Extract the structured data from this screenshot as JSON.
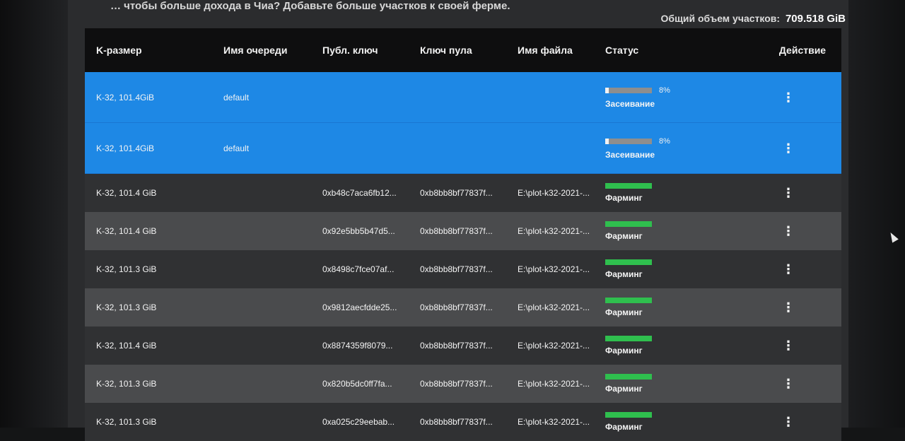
{
  "notice": "… чтобы больше дохода в Чиа? Добавьте больше участков к своей ферме.",
  "total": {
    "label": "Общий объем участков:",
    "value": "709.518 GiB"
  },
  "columns": {
    "k_size": "K-размер",
    "queue": "Имя очереди",
    "public_key": "Публ. ключ",
    "pool_key": "Ключ пула",
    "filename": "Имя файла",
    "status": "Статус",
    "action": "Действие"
  },
  "rows": [
    {
      "k_size": "K-32, 101.4GiB",
      "queue": "default",
      "public_key": "",
      "pool_key": "",
      "filename": "",
      "status": "Засеивание",
      "progress": "8%",
      "progress_value": 0.08,
      "state": "plotting",
      "shade": "selected"
    },
    {
      "k_size": "K-32, 101.4GiB",
      "queue": "default",
      "public_key": "",
      "pool_key": "",
      "filename": "",
      "status": "Засеивание",
      "progress": "8%",
      "progress_value": 0.08,
      "state": "plotting",
      "shade": "selected"
    },
    {
      "k_size": "K-32, 101.4 GiB",
      "queue": "",
      "public_key": "0xb48c7aca6fb12...",
      "pool_key": "0xb8bb8bf77837f...",
      "filename": "E:\\plot-k32-2021-...",
      "status": "Фарминг",
      "progress": "",
      "progress_value": 1,
      "state": "farming",
      "shade": "dark"
    },
    {
      "k_size": "K-32, 101.4 GiB",
      "queue": "",
      "public_key": "0x92e5bb5b47d5...",
      "pool_key": "0xb8bb8bf77837f...",
      "filename": "E:\\plot-k32-2021-...",
      "status": "Фарминг",
      "progress": "",
      "progress_value": 1,
      "state": "farming",
      "shade": "light"
    },
    {
      "k_size": "K-32, 101.3 GiB",
      "queue": "",
      "public_key": "0x8498c7fce07af...",
      "pool_key": "0xb8bb8bf77837f...",
      "filename": "E:\\plot-k32-2021-...",
      "status": "Фарминг",
      "progress": "",
      "progress_value": 1,
      "state": "farming",
      "shade": "dark"
    },
    {
      "k_size": "K-32, 101.3 GiB",
      "queue": "",
      "public_key": "0x9812aecfdde25...",
      "pool_key": "0xb8bb8bf77837f...",
      "filename": "E:\\plot-k32-2021-...",
      "status": "Фарминг",
      "progress": "",
      "progress_value": 1,
      "state": "farming",
      "shade": "light"
    },
    {
      "k_size": "K-32, 101.4 GiB",
      "queue": "",
      "public_key": "0x8874359f8079...",
      "pool_key": "0xb8bb8bf77837f...",
      "filename": "E:\\plot-k32-2021-...",
      "status": "Фарминг",
      "progress": "",
      "progress_value": 1,
      "state": "farming",
      "shade": "dark"
    },
    {
      "k_size": "K-32, 101.3 GiB",
      "queue": "",
      "public_key": "0x820b5dc0ff7fa...",
      "pool_key": "0xb8bb8bf77837f...",
      "filename": "E:\\plot-k32-2021-...",
      "status": "Фарминг",
      "progress": "",
      "progress_value": 1,
      "state": "farming",
      "shade": "light"
    },
    {
      "k_size": "K-32, 101.3 GiB",
      "queue": "",
      "public_key": "0xa025c29eebab...",
      "pool_key": "0xb8bb8bf77837f...",
      "filename": "E:\\plot-k32-2021-...",
      "status": "Фарминг",
      "progress": "",
      "progress_value": 1,
      "state": "farming",
      "shade": "dark"
    }
  ],
  "action_icon": "more-vertical-icon",
  "colors": {
    "selected_row": "#1e88e5",
    "farming_bar": "#2fbf4e",
    "plotting_bar": "#8e8e8e",
    "header_bg": "#0e0e0f"
  }
}
